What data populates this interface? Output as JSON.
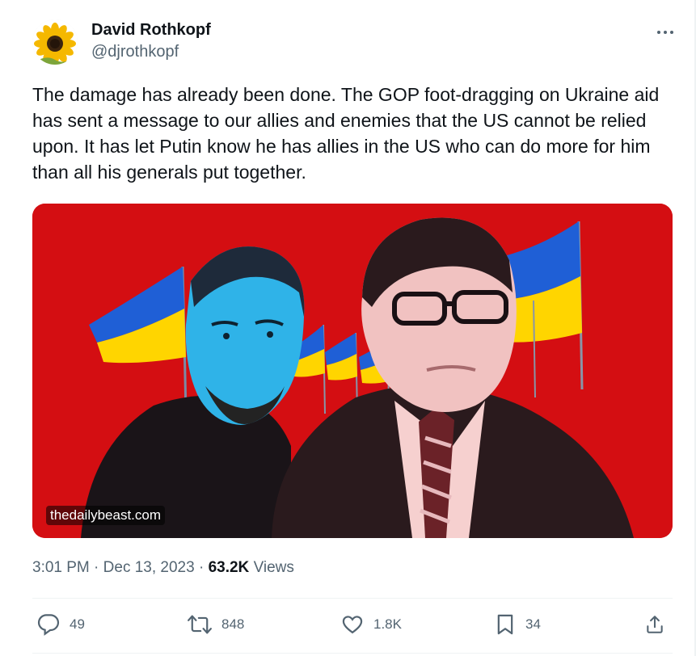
{
  "author": {
    "name": "David Rothkopf",
    "handle": "@djrothkopf",
    "avatar_icon": "sunflower-icon"
  },
  "tweet": {
    "text": "The damage has already been done. The GOP foot-dragging on Ukraine aid has sent a message to our allies and enemies that the US cannot be relied upon. It has let Putin know he has allies in the US who can do more for him than all his generals put together."
  },
  "media": {
    "source_label": "thedailybeast.com",
    "background_color": "#d40e12",
    "flag_colors": [
      "#1f5fd6",
      "#ffd500"
    ]
  },
  "meta": {
    "time": "3:01 PM",
    "separator": "·",
    "date": "Dec 13, 2023",
    "views_count": "63.2K",
    "views_label": "Views"
  },
  "actions": {
    "replies": "49",
    "reposts": "848",
    "likes": "1.8K",
    "bookmarks": "34"
  },
  "colors": {
    "text_primary": "#0f1419",
    "text_secondary": "#536471",
    "border": "#eff3f4"
  }
}
